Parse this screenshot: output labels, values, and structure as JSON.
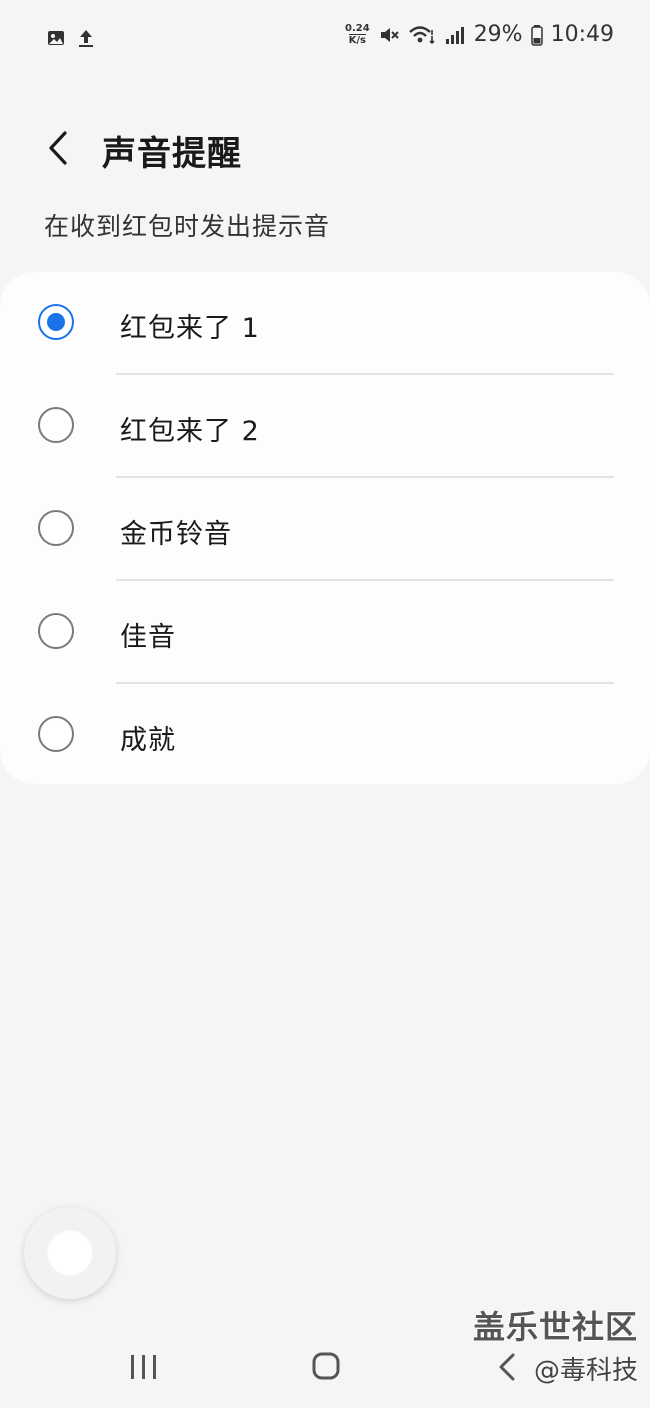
{
  "status_bar": {
    "left_icons": [
      "image-icon",
      "upload-icon"
    ],
    "net_speed_value": "0.24",
    "net_speed_unit": "K/s",
    "battery": "29%",
    "time": "10:49",
    "icons": [
      "mute-icon",
      "wifi-icon",
      "signal-icon",
      "battery-icon"
    ]
  },
  "header": {
    "title": "声音提醒",
    "back_icon": "chevron-left-icon"
  },
  "subtitle": "在收到红包时发出提示音",
  "options": [
    {
      "label": "红包来了 1",
      "selected": true
    },
    {
      "label": "红包来了 2",
      "selected": false
    },
    {
      "label": "金币铃音",
      "selected": false
    },
    {
      "label": "佳音",
      "selected": false
    },
    {
      "label": "成就",
      "selected": false
    }
  ],
  "colors": {
    "accent": "#1a73e8",
    "background": "#f5f5f5",
    "card": "#fdfdfd"
  },
  "watermark": {
    "main": "盖乐世社区",
    "sub": "@毒科技"
  },
  "navbar": {
    "icons": [
      "recent-apps-icon",
      "home-icon",
      "back-icon"
    ]
  }
}
